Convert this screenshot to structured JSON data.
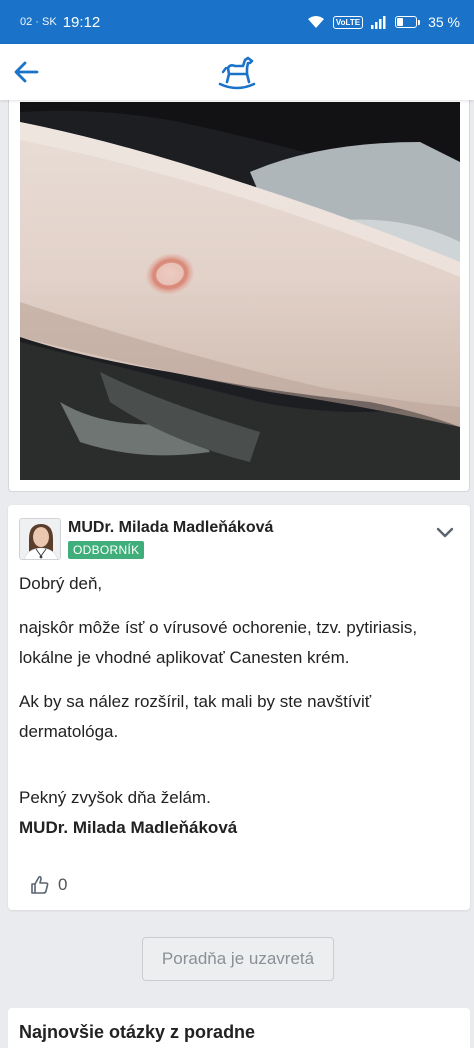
{
  "status_bar": {
    "carrier": "02 · SK",
    "time": "19:12",
    "volte": "VoLTE",
    "battery_percent": "35 %",
    "battery_level": 0.35
  },
  "app_bar": {
    "back_icon": "arrow-left-icon",
    "logo_icon": "rocking-horse-logo"
  },
  "answer": {
    "author": "MUDr. Milada Madleňáková",
    "badge": "ODBORNÍK",
    "paragraphs": [
      "Dobrý deň,",
      "najskôr môže ísť o vírusové ochorenie, tzv. pytiriasis, lokálne je vhodné aplikovať Canesten krém.",
      "Ak by sa nález rozšíril, tak mali by ste navštíviť dermatológa."
    ],
    "closing": "Pekný zvyšok dňa želám.",
    "signature": "MUDr. Milada Madleňáková",
    "likes": "0"
  },
  "closed_button": "Poradňa je uzavretá",
  "latest_section": {
    "title": "Najnovšie otázky z poradne"
  },
  "colors": {
    "status_bar": "#1a73c8",
    "accent": "#1a73c8",
    "badge": "#3fae7a"
  }
}
